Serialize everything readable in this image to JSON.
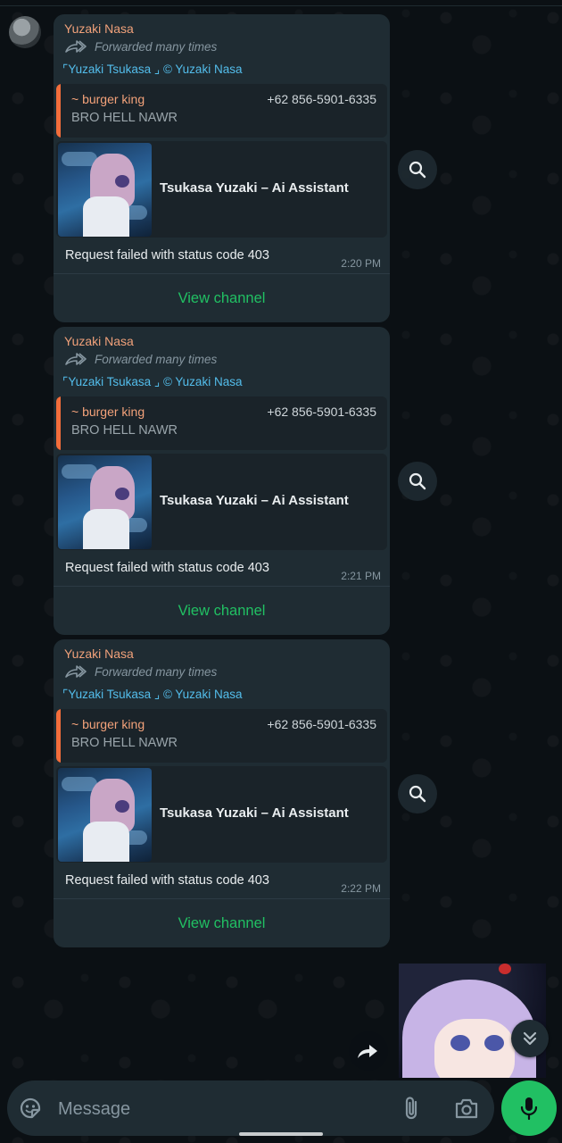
{
  "theme": {
    "accent": "#21c063",
    "sender_color": "#f0a17a",
    "channel_color": "#53bdeb",
    "quote_bar": "#f26d3b",
    "bubble": "#1f2c33"
  },
  "messages": [
    {
      "sender": "Yuzaki Nasa",
      "forwarded": "Forwarded many times",
      "channel": "⌜Yuzaki Tsukasa ⌟ © Yuzaki Nasa",
      "quote": {
        "name": "~ burger king",
        "phone": "+62 856-5901-6335",
        "text": "BRO HELL NAWR"
      },
      "preview_title": "Tsukasa Yuzaki – Ai Assistant",
      "text": "Request failed with status code 403",
      "time": "2:20 PM",
      "button": "View channel"
    },
    {
      "sender": "Yuzaki Nasa",
      "forwarded": "Forwarded many times",
      "channel": "⌜Yuzaki Tsukasa ⌟ © Yuzaki Nasa",
      "quote": {
        "name": "~ burger king",
        "phone": "+62 856-5901-6335",
        "text": "BRO HELL NAWR"
      },
      "preview_title": "Tsukasa Yuzaki – Ai Assistant",
      "text": "Request failed with status code 403",
      "time": "2:21 PM",
      "button": "View channel"
    },
    {
      "sender": "Yuzaki Nasa",
      "forwarded": "Forwarded many times",
      "channel": "⌜Yuzaki Tsukasa ⌟ © Yuzaki Nasa",
      "quote": {
        "name": "~ burger king",
        "phone": "+62 856-5901-6335",
        "text": "BRO HELL NAWR"
      },
      "preview_title": "Tsukasa Yuzaki – Ai Assistant",
      "text": "Request failed with status code 403",
      "time": "2:22 PM",
      "button": "View channel"
    }
  ],
  "composer": {
    "placeholder": "Message"
  },
  "icons": {
    "forwarded": "forward-double-arrow-icon",
    "search": "search-icon",
    "forward": "forward-icon",
    "scroll_down": "double-chevron-down-icon",
    "emoji": "sticker-icon",
    "attach": "paperclip-icon",
    "camera": "camera-icon",
    "mic": "mic-icon"
  }
}
